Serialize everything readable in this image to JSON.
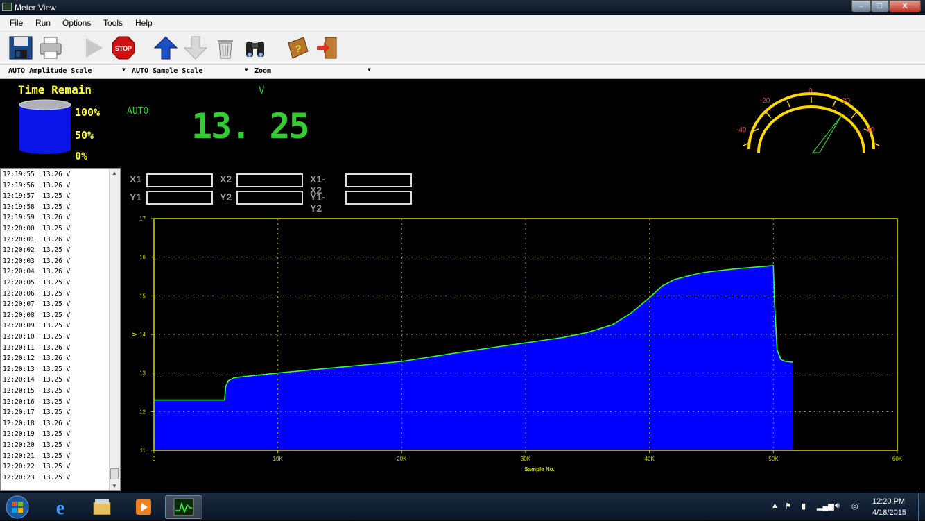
{
  "window": {
    "title": "Meter View",
    "min": "–",
    "max": "□",
    "close": "X"
  },
  "menu": {
    "file": "File",
    "run": "Run",
    "options": "Options",
    "tools": "Tools",
    "help": "Help"
  },
  "toolbar": [
    "save-icon",
    "print-icon",
    "play-icon",
    "stop-icon",
    "up-arrow-icon",
    "down-arrow-icon",
    "trash-icon",
    "binoculars-icon",
    "help-book-icon",
    "exit-icon"
  ],
  "selectors": {
    "amplitude": "AUTO Amplitude Scale",
    "sample": "AUTO Sample Scale",
    "zoom": "Zoom"
  },
  "gauge_panel": {
    "title": "Time Remain",
    "p100": "100%",
    "p50": "50%",
    "p0": "0%",
    "fill_fraction": 1.0
  },
  "meter": {
    "mode": "AUTO",
    "unit": "V",
    "value": "13. 25"
  },
  "analog_gauge": {
    "labels": [
      "-40",
      "-20",
      "0",
      "20",
      "40"
    ],
    "needle_value": 25
  },
  "log": {
    "rows": [
      "12:19:55  13.26 V",
      "12:19:56  13.26 V",
      "12:19:57  13.25 V",
      "12:19:58  13.25 V",
      "12:19:59  13.26 V",
      "12:20:00  13.25 V",
      "12:20:01  13.26 V",
      "12:20:02  13.25 V",
      "12:20:03  13.26 V",
      "12:20:04  13.26 V",
      "12:20:05  13.25 V",
      "12:20:06  13.25 V",
      "12:20:07  13.25 V",
      "12:20:08  13.25 V",
      "12:20:09  13.25 V",
      "12:20:10  13.25 V",
      "12:20:11  13.26 V",
      "12:20:12  13.26 V",
      "12:20:13  13.25 V",
      "12:20:14  13.25 V",
      "12:20:15  13.25 V",
      "12:20:16  13.25 V",
      "12:20:17  13.25 V",
      "12:20:18  13.26 V",
      "12:20:19  13.25 V",
      "12:20:20  13.25 V",
      "12:20:21  13.25 V",
      "12:20:22  13.25 V",
      "12:20:23  13.25 V"
    ]
  },
  "cursors": {
    "x1": "X1",
    "x2": "X2",
    "x1x2": "X1-X2",
    "y1": "Y1",
    "y2": "Y2",
    "y1y2": "Y1-Y2"
  },
  "chart_data": {
    "type": "area",
    "xlabel": "Sample No.",
    "ylabel": "V",
    "xlim": [
      0,
      60000
    ],
    "ylim": [
      11,
      17
    ],
    "x_ticks": [
      "0",
      "10K",
      "20K",
      "30K",
      "40K",
      "50K",
      "60K"
    ],
    "y_ticks": [
      "11",
      "12",
      "13",
      "14",
      "15",
      "16",
      "17"
    ],
    "grid": true,
    "fill_color": "#0000ff",
    "line_color": "#33ff33",
    "x": [
      0,
      5700,
      5800,
      6000,
      6500,
      10000,
      15000,
      20000,
      25000,
      30000,
      33000,
      35000,
      37000,
      38500,
      40000,
      41000,
      42000,
      43000,
      44000,
      45000,
      47000,
      50000,
      50100,
      50300,
      50600,
      51000,
      51600
    ],
    "y": [
      12.3,
      12.3,
      12.65,
      12.8,
      12.88,
      13.0,
      13.15,
      13.3,
      13.55,
      13.78,
      13.92,
      14.05,
      14.25,
      14.55,
      14.95,
      15.25,
      15.42,
      15.5,
      15.58,
      15.63,
      15.7,
      15.78,
      14.8,
      13.6,
      13.35,
      13.3,
      13.28
    ]
  },
  "taskbar": {
    "time": "12:20 PM",
    "date": "4/18/2015"
  }
}
